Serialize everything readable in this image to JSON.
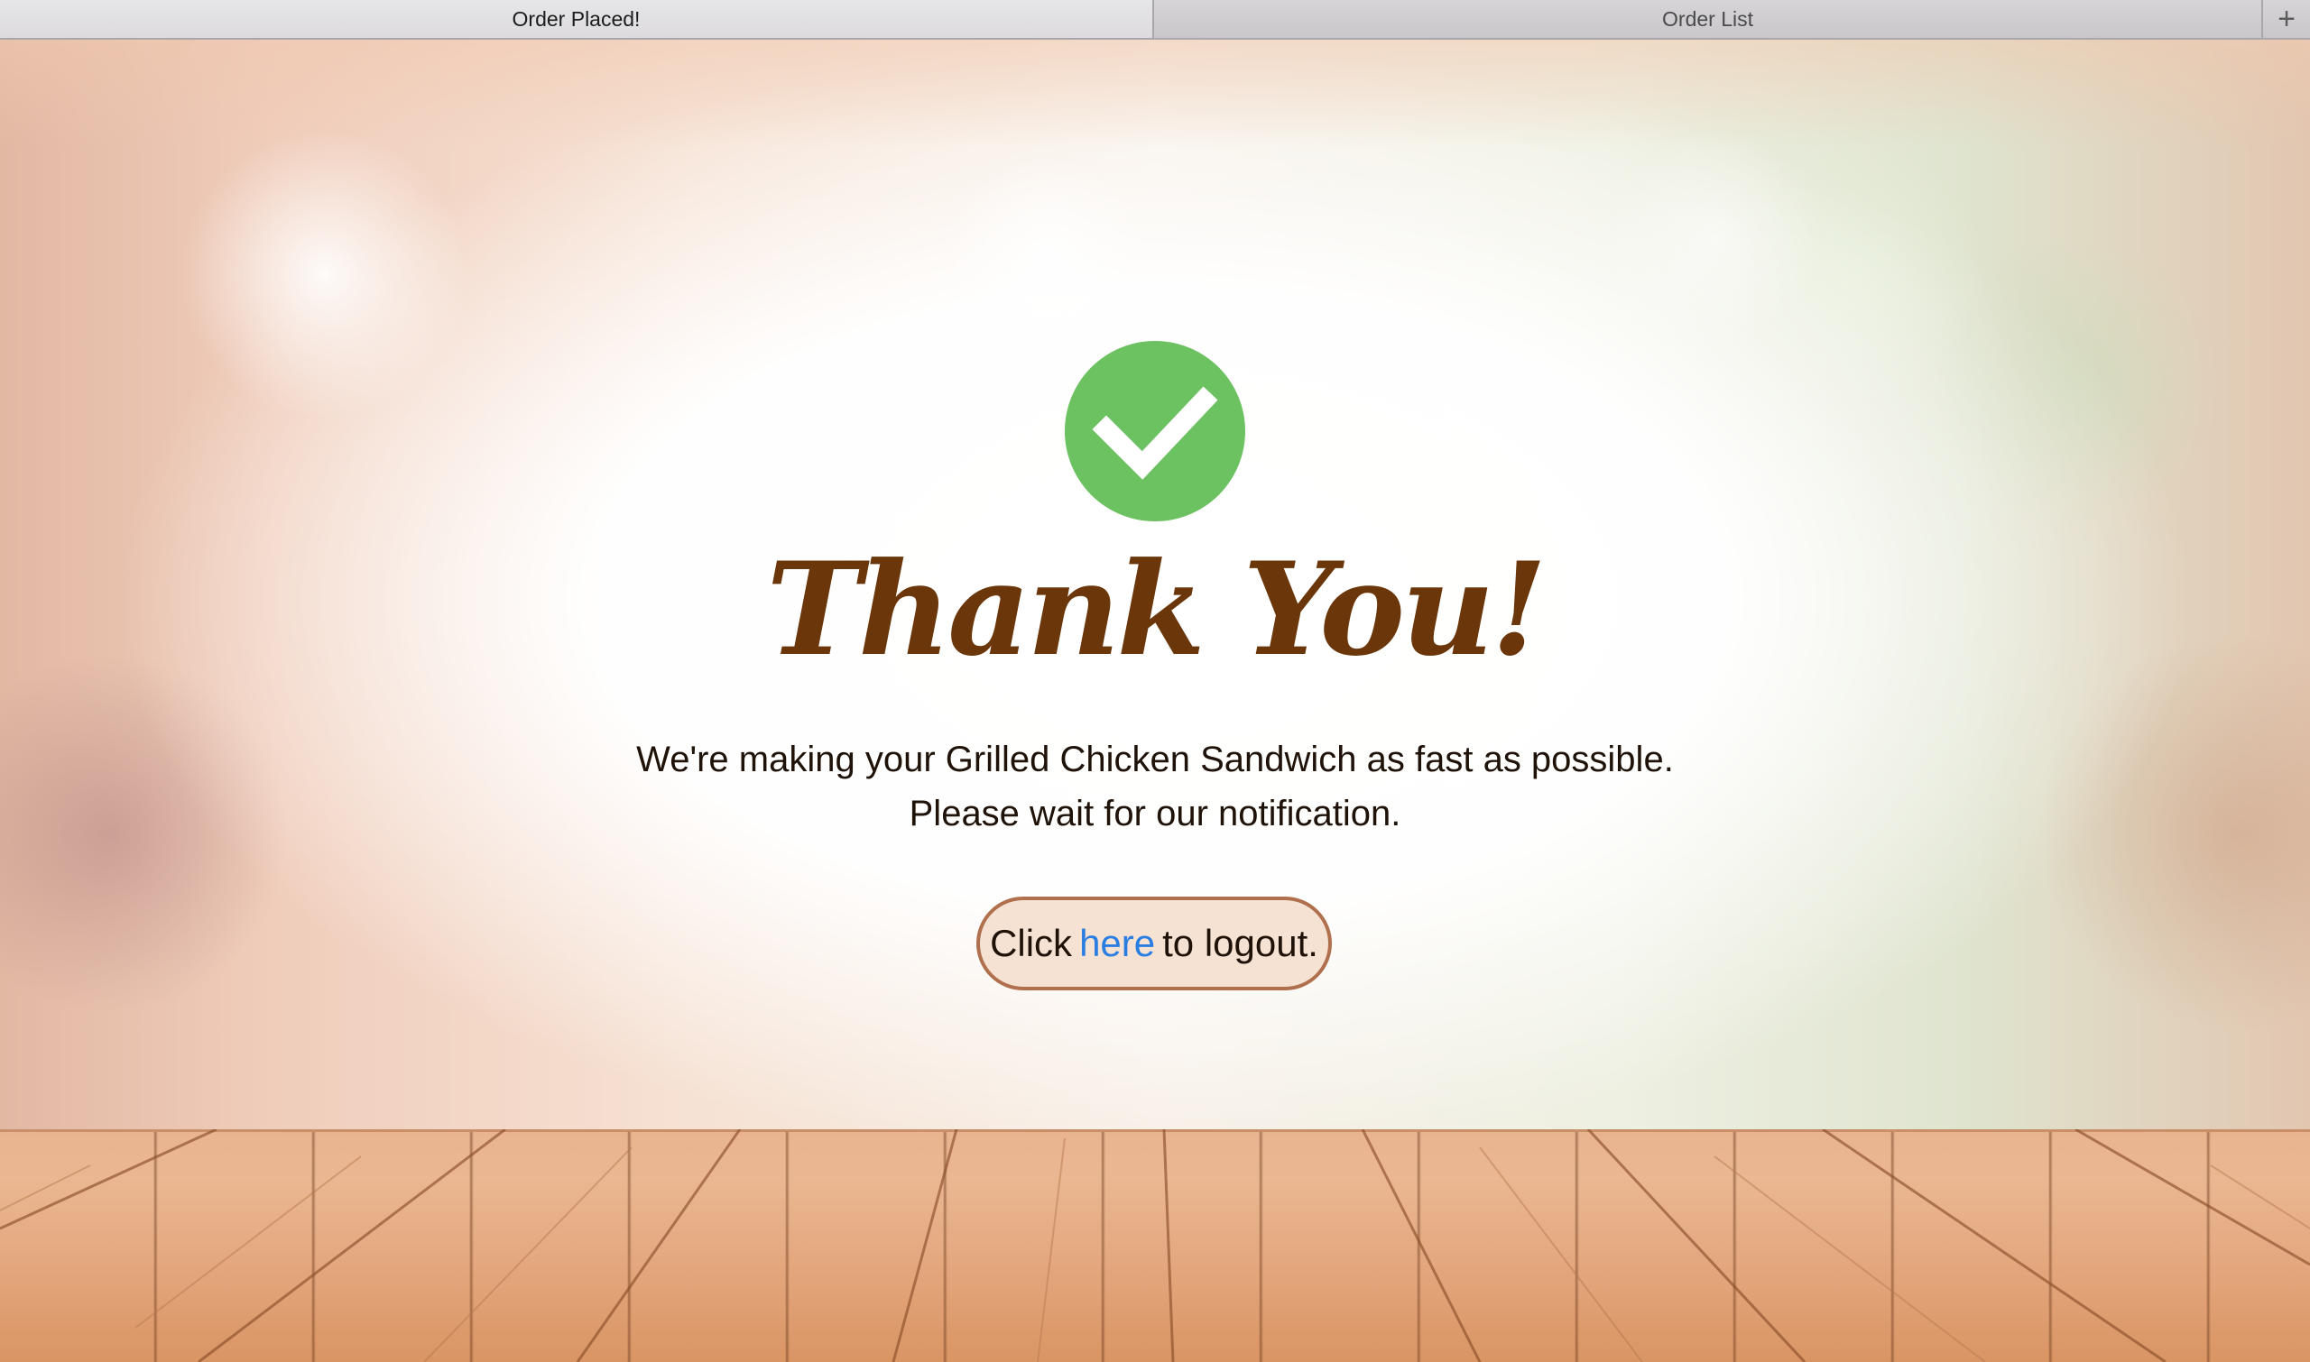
{
  "tabs": [
    {
      "label": "Order Placed!",
      "active": true
    },
    {
      "label": "Order List",
      "active": false
    }
  ],
  "new_tab_symbol": "+",
  "icons": {
    "success": "checkmark-icon",
    "new_tab": "plus-icon"
  },
  "colors": {
    "success_green": "#6cc160",
    "title_brown": "#6b3609",
    "link_blue": "#2a7de1",
    "pill_border": "#b0704d",
    "pill_fill": "#f5e2d3"
  },
  "confirmation": {
    "title": "Thank You!",
    "message_line1": "We're making your Grilled Chicken Sandwich as fast as possible.",
    "message_line2": "Please wait for our notification.",
    "logout_prefix": "Click",
    "logout_link": "here",
    "logout_suffix": "to logout."
  }
}
